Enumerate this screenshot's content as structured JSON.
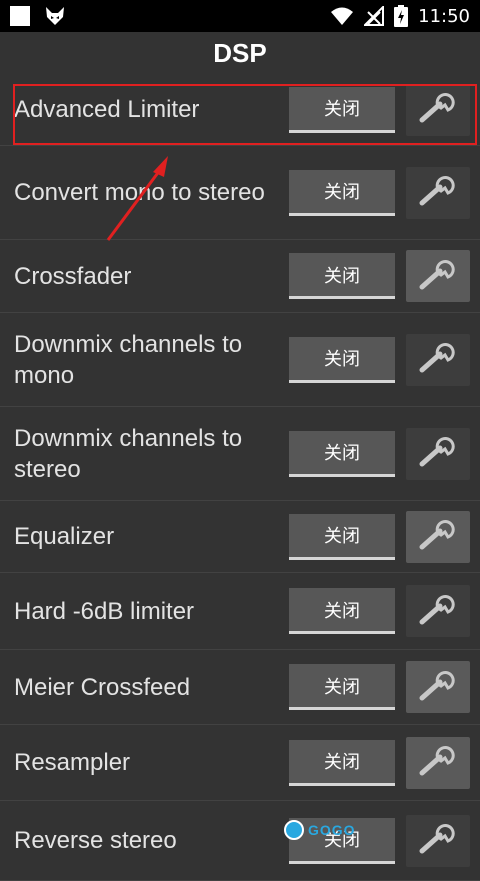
{
  "status_bar": {
    "time": "11:50",
    "icons": [
      "notification-square-icon",
      "fox-app-icon",
      "wifi-icon",
      "signal-off-icon",
      "battery-charging-icon"
    ]
  },
  "header": {
    "title": "DSP"
  },
  "dsp_items": [
    {
      "label": "Advanced Limiter",
      "toggle_label": "关闭"
    },
    {
      "label": "Convert mono to stereo",
      "toggle_label": "关闭"
    },
    {
      "label": "Crossfader",
      "toggle_label": "关闭"
    },
    {
      "label": "Downmix channels to mono",
      "toggle_label": "关闭"
    },
    {
      "label": "Downmix channels to stereo",
      "toggle_label": "关闭"
    },
    {
      "label": "Equalizer",
      "toggle_label": "关闭"
    },
    {
      "label": "Hard -6dB limiter",
      "toggle_label": "关闭"
    },
    {
      "label": "Meier Crossfeed",
      "toggle_label": "关闭"
    },
    {
      "label": "Resampler",
      "toggle_label": "关闭"
    },
    {
      "label": "Reverse stereo",
      "toggle_label": "关闭"
    }
  ],
  "watermark": {
    "text": "GOGO"
  },
  "colors": {
    "annotation": "#e02020",
    "background": "#333333",
    "toggle": "#575757"
  }
}
